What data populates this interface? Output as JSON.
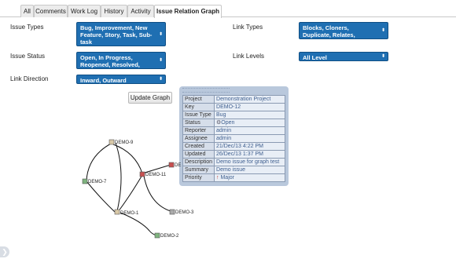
{
  "tabs": [
    {
      "label": "All"
    },
    {
      "label": "Comments"
    },
    {
      "label": "Work Log"
    },
    {
      "label": "History"
    },
    {
      "label": "Activity"
    },
    {
      "label": "Issue Relation Graph"
    }
  ],
  "filters": {
    "issue_types": {
      "label": "Issue Types",
      "value": "Bug, Improvement, New Feature, Story, Task, Sub-task"
    },
    "issue_status": {
      "label": "Issue Status",
      "value": "Open, In Progress, Reopened, Resolved, Closed"
    },
    "link_direction": {
      "label": "Link Direction",
      "value": "Inward, Outward"
    },
    "link_types": {
      "label": "Link Types",
      "value": "Blocks, Cloners, Duplicate, Relates, Subtask Link"
    },
    "link_levels": {
      "label": "Link Levels",
      "value": "All Level"
    }
  },
  "update_button": "Update Graph",
  "popup": {
    "rows": [
      {
        "key": "Project",
        "value": "Demonstration Project"
      },
      {
        "key": "Key",
        "value": "DEMO-12"
      },
      {
        "key": "Issue Type",
        "value": "Bug"
      },
      {
        "key": "Status",
        "value": "Open"
      },
      {
        "key": "Reporter",
        "value": "admin"
      },
      {
        "key": "Assignee",
        "value": "admin"
      },
      {
        "key": "Created",
        "value": "21/Dec/13 4:22 PM"
      },
      {
        "key": "Updated",
        "value": "26/Dec/13 1:37 PM"
      },
      {
        "key": "Description",
        "value": "Demo issue for graph test"
      },
      {
        "key": "Summary",
        "value": "Demo issue"
      },
      {
        "key": "Priority",
        "value": "Major"
      }
    ]
  },
  "graph": {
    "nodes": [
      {
        "label": "DEMO-9",
        "color": "#d9c9a8"
      },
      {
        "label": "DEMO-7",
        "color": "#7fb47f"
      },
      {
        "label": "DEMO-11",
        "color": "#c75050"
      },
      {
        "label": "DEMO-1",
        "color": "#d9c9a8"
      },
      {
        "label": "DEMO-3",
        "color": "#aaaaaa"
      },
      {
        "label": "DEMO-2",
        "color": "#7fb47f"
      },
      {
        "label": "DE",
        "color": "#c75050"
      }
    ]
  },
  "colors": {
    "accent": "#1f6fb2",
    "popup_bg": "#b9c8dc"
  }
}
